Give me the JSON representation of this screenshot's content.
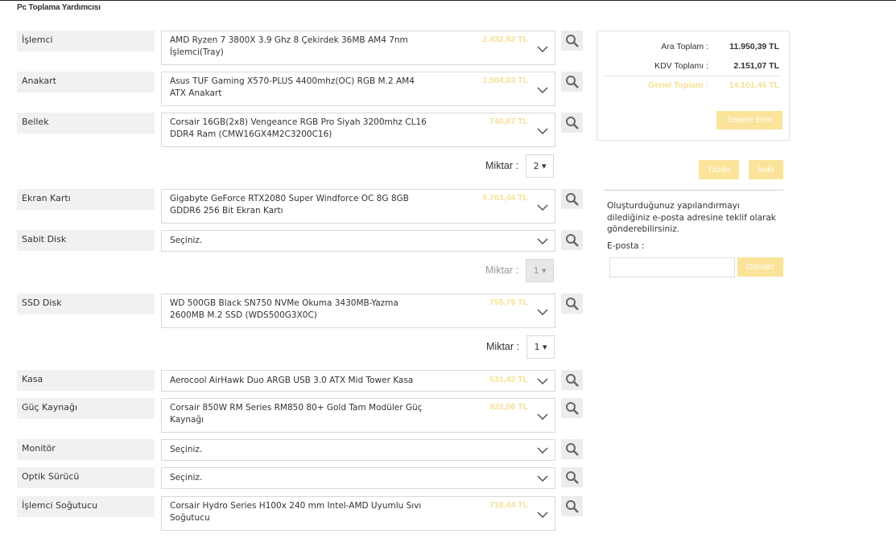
{
  "page": {
    "title": "Pc Toplama Yardımcısı"
  },
  "rows": [
    {
      "label": "İşlemci",
      "product": "AMD Ryzen 7 3800X 3.9 Ghz 8 Çekirdek 36MB AM4 7nm İşlemci(Tray)",
      "price": "2.432,92 TL"
    },
    {
      "label": "Anakart",
      "product": "Asus TUF Gaming X570-PLUS 4400mhz(OC) RGB M.2 AM4 ATX Anakart",
      "price": "1.504,03 TL"
    },
    {
      "label": "Bellek",
      "product": "Corsair 16GB(2x8) Vengeance RGB Pro Siyah 3200mhz CL16 DDR4 Ram (CMW16GX4M2C3200C16)",
      "price": "740,67 TL"
    },
    {
      "label": "Ekran Kartı",
      "product": "Gigabyte GeForce RTX2080 Super Windforce OC 8G 8GB GDDR6 256 Bit Ekran Kartı",
      "price": "5.763,44 TL"
    },
    {
      "label": "Sabit Disk",
      "product": "Seçiniz.",
      "price": ""
    },
    {
      "label": "SSD Disk",
      "product": "WD 500GB Black SN750 NVMe Okuma 3430MB-Yazma 2600MB M.2 SSD (WDS500G3X0C)",
      "price": "755,79 TL"
    },
    {
      "label": "Kasa",
      "product": "Aerocool AirHawk Duo ARGB USB 3.0 ATX Mid Tower Kasa",
      "price": "531,42 TL"
    },
    {
      "label": "Güç Kaynağı",
      "product": "Corsair 850W RM Series RM850 80+ Gold Tam Modüler Güç Kaynağı",
      "price": "922,06 TL"
    },
    {
      "label": "Monitör",
      "product": "Seçiniz.",
      "price": ""
    },
    {
      "label": "Optik Sürücü",
      "product": "Seçiniz.",
      "price": ""
    },
    {
      "label": "İşlemci Soğutucu",
      "product": "Corsair Hydro Series H100x 240 mm Intel-AMD Uyumlu Sıvı Soğutucu",
      "price": "710,44 TL"
    }
  ],
  "quantities": [
    {
      "label": "Miktar :",
      "value": "2 ▾"
    },
    {
      "label": "Miktar :",
      "value": "1 ▾"
    },
    {
      "label": "Miktar :",
      "value": "1 ▾"
    }
  ],
  "summary": {
    "subtotal_label": "Ara Toplam :",
    "subtotal_value": "11.950,39 TL",
    "vat_label": "KDV Toplamı :",
    "vat_value": "2.151,07 TL",
    "grand_label": "Genel Toplam :",
    "grand_value": "14.101,46 TL",
    "add_to_cart": "Sepete Ekle"
  },
  "actions": {
    "print": "Yazdır",
    "download": "İndir"
  },
  "share": {
    "info": "Oluşturduğunuz yapılandırmayı dilediğiniz e-posta adresine teklif olarak gönderebilirsiniz.",
    "email_label": "E-posta :",
    "email_placeholder": "",
    "send": "Gönder"
  },
  "colors": {
    "accent": "#fbe39a",
    "price": "#f7df91",
    "label_bg": "#f1f1f1"
  }
}
